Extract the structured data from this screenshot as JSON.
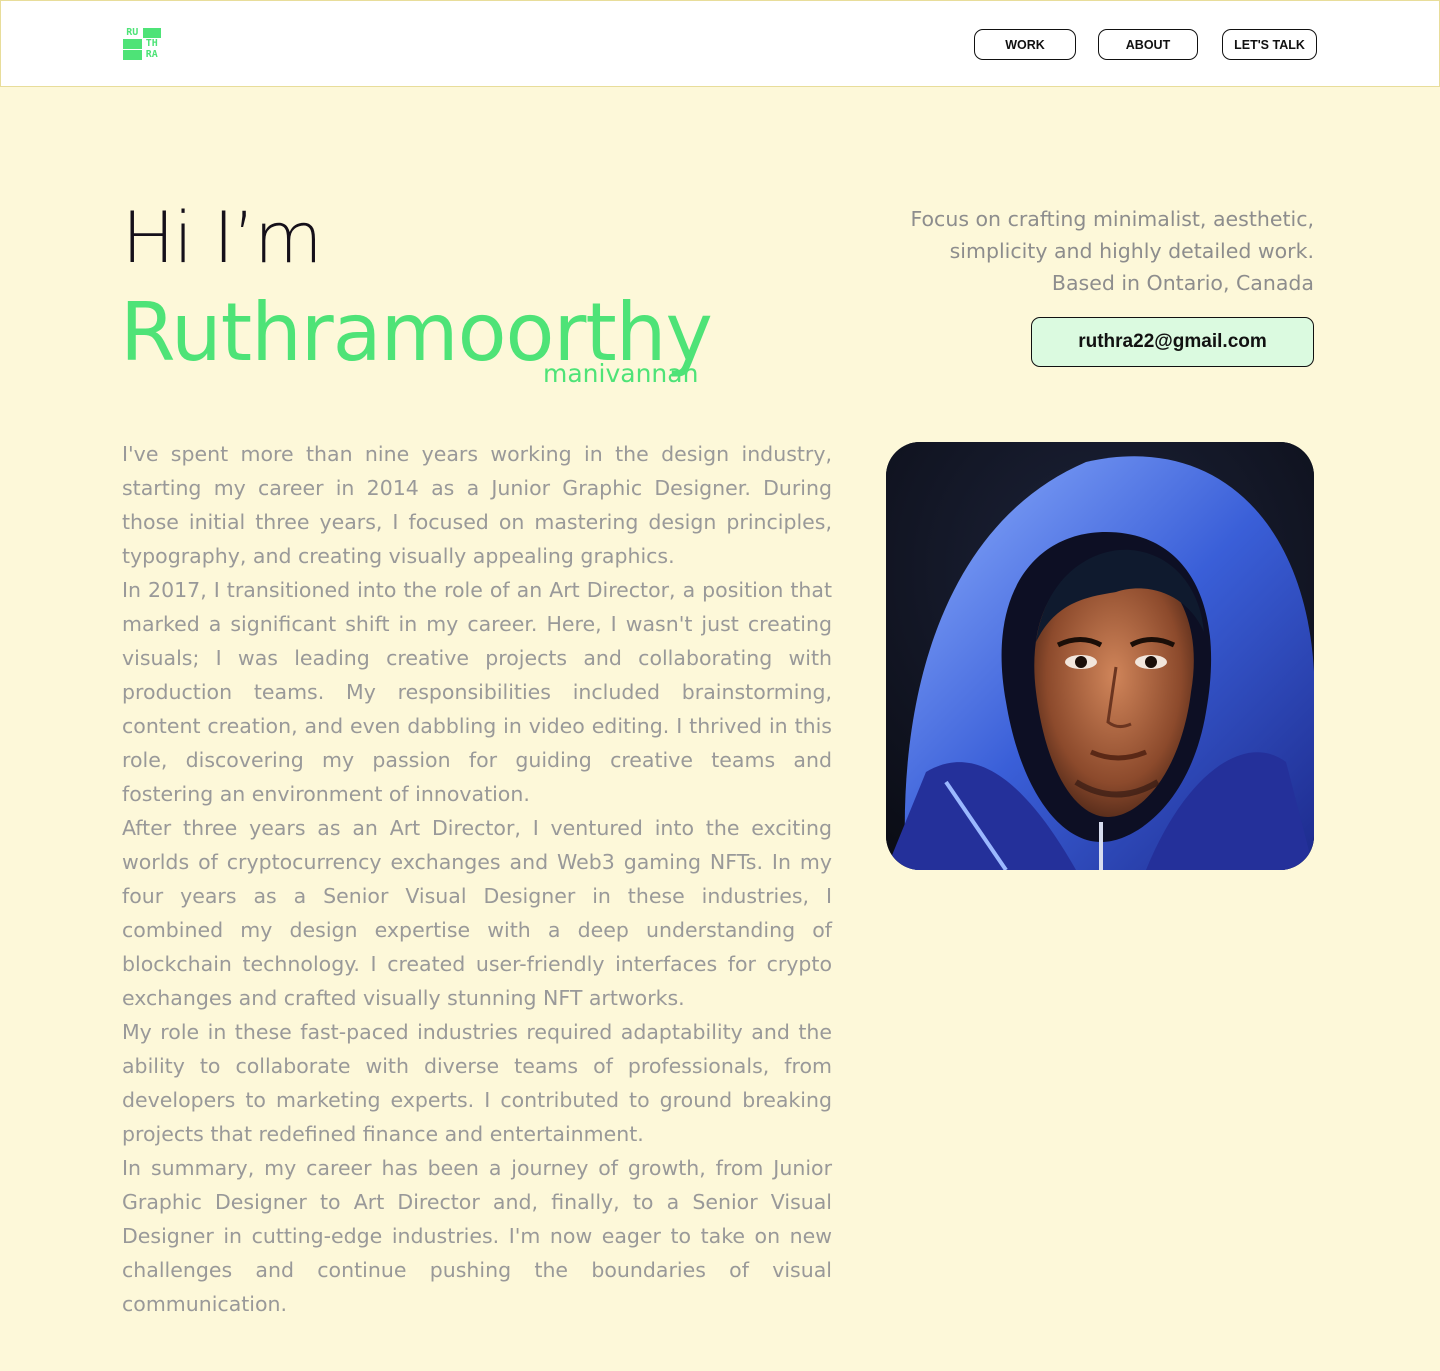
{
  "logo": {
    "cells": [
      "RU",
      "TH",
      "RA"
    ],
    "icon": "ruthra-logo-icon",
    "color": "#4ee377"
  },
  "nav": {
    "work_label": "WORK",
    "about_label": "ABOUT",
    "talk_label": "LET'S TALK"
  },
  "hero": {
    "greeting": "Hi I’m",
    "name": "Ruthramoorthy",
    "surname": "manivannan",
    "tagline": [
      "Focus on crafting minimalist, aesthetic,",
      "simplicity and highly detailed work.",
      "Based in Ontario, Canada"
    ],
    "email": "ruthra22@gmail.com"
  },
  "bio": [
    "I've spent more than nine years working in the design industry, starting my career in 2014 as a Junior Graphic Designer. During those initial three years, I focused on mastering design principles, typography, and creating visually appealing graphics.",
    "In 2017, I transitioned into the role of an Art Director, a position that marked a significant shift in my career. Here, I wasn't just creating visuals; I was leading creative projects and collaborating with production teams. My responsibilities included brainstorming, content creation, and even dabbling in video editing. I thrived in this role, discovering my passion for guiding creative teams and fostering an environment of innovation.",
    "After three years as an Art Director, I ventured into the exciting worlds of cryptocurrency exchanges and Web3 gaming NFTs. In my four years as a Senior Visual Designer in these industries, I combined my design expertise with a deep understanding of blockchain technology. I created user-friendly interfaces for crypto exchanges and crafted visually stunning NFT artworks.",
    "My role in these fast-paced industries required adaptability and the ability to collaborate with diverse teams of professionals, from developers to marketing experts. I contributed to ground breaking projects that redefined finance and entertainment.",
    "In summary, my career has been a journey of growth, from Junior Graphic Designer to Art Director and, finally, to a Senior Visual Designer in cutting-edge industries. I'm now eager to take on new challenges and continue pushing the boundaries of visual communication."
  ],
  "portrait": {
    "icon": "portrait-illustration",
    "hood_color": "#3a5fd8"
  },
  "colors": {
    "accent": "#4ee377",
    "background": "#fdf8d9",
    "body_text": "#999999"
  }
}
